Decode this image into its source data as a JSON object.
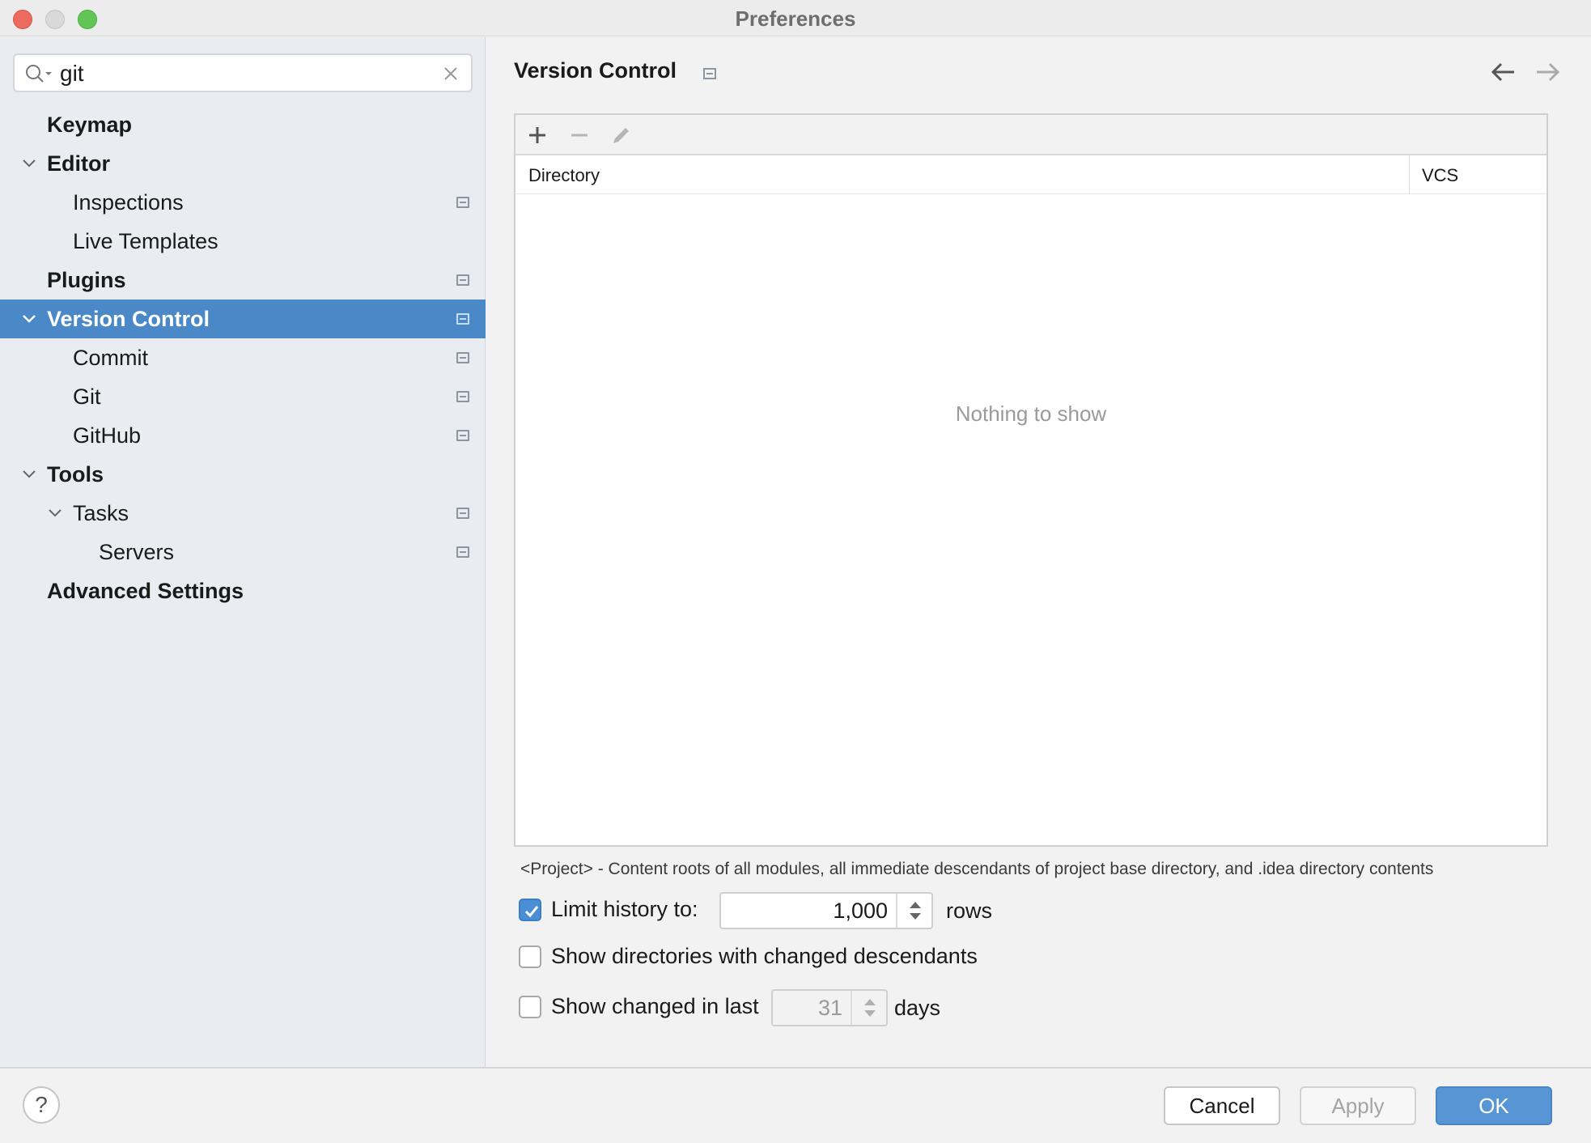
{
  "window": {
    "title": "Preferences"
  },
  "sidebar": {
    "search": {
      "value": "git"
    },
    "items": [
      {
        "label": "Keymap"
      },
      {
        "label": "Editor"
      },
      {
        "label": "Inspections"
      },
      {
        "label": "Live Templates"
      },
      {
        "label": "Plugins"
      },
      {
        "label": "Version Control"
      },
      {
        "label": "Commit"
      },
      {
        "label": "Git"
      },
      {
        "label": "GitHub"
      },
      {
        "label": "Tools"
      },
      {
        "label": "Tasks"
      },
      {
        "label": "Servers"
      },
      {
        "label": "Advanced Settings"
      }
    ]
  },
  "main": {
    "title": "Version Control",
    "table": {
      "columns": [
        "Directory",
        "VCS"
      ],
      "empty_text": "Nothing to show"
    },
    "hint": "<Project> - Content roots of all modules, all immediate descendants of project base directory, and .idea directory contents",
    "options": {
      "limit_history": {
        "label": "Limit history to:",
        "checked": true,
        "value": "1,000",
        "suffix": "rows"
      },
      "show_dirs": {
        "label": "Show directories with changed descendants",
        "checked": false
      },
      "show_changed": {
        "label": "Show changed in last",
        "checked": false,
        "value": "31",
        "suffix": "days"
      }
    }
  },
  "footer": {
    "help_label": "?",
    "cancel_label": "Cancel",
    "apply_label": "Apply",
    "ok_label": "OK"
  },
  "colors": {
    "selection": "#4a88c7",
    "ok_button": "#5895d5",
    "checkbox_checked": "#4a8fd6"
  }
}
